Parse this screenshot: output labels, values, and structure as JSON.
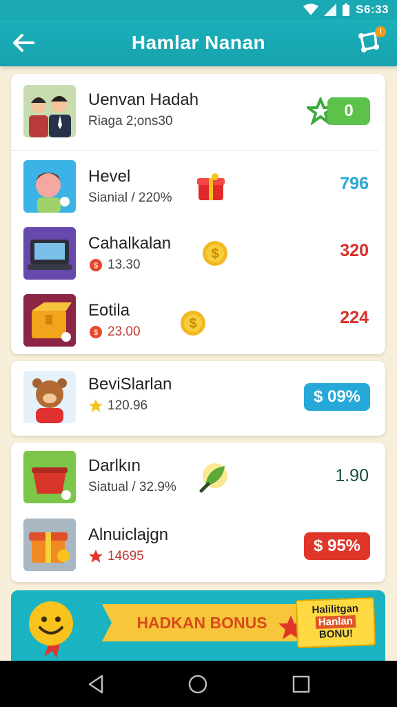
{
  "status_bar": {
    "time": "S6:33"
  },
  "header": {
    "title": "Hamlar Nanan",
    "notification_badge": "!"
  },
  "cards": [
    {
      "rows": [
        {
          "title": "Uenvan Hadah",
          "subtitle": "Riaga 2;ons30",
          "value": "0",
          "value_color": "#ffffff",
          "value_style": "green-pill"
        },
        {
          "title": "Hevel",
          "subtitle": "Sianial / 220%",
          "value": "796",
          "value_color": "#2aa6d6"
        },
        {
          "title": "Cahalkalan",
          "subtitle": "13.30",
          "value": "320",
          "value_color": "#d9302a"
        },
        {
          "title": "Eotila",
          "subtitle": "23.00",
          "value": "224",
          "value_color": "#d9302a"
        }
      ]
    },
    {
      "rows": [
        {
          "title": "BeviSlarlan",
          "subtitle": "120.96",
          "value": "$ 09%",
          "value_color": "#2aa6d6"
        }
      ]
    },
    {
      "rows": [
        {
          "title": "Darlkın",
          "subtitle": "Siatual / 32.9%",
          "value": "1.90",
          "value_color": "#1b4d3e"
        },
        {
          "title": "Alnuiclajgn",
          "subtitle": "14695",
          "value": "$ 95%",
          "value_color": "#e0362a"
        }
      ]
    }
  ],
  "banner": {
    "ribbon_text": "HADKAN BONUS",
    "sign_line1": "Halilitgan",
    "sign_line2": "Hanlan",
    "sign_line3": "BONU!"
  },
  "icons": {
    "back": "arrow-left",
    "share": "share-network",
    "star": "star",
    "coin": "coin",
    "gift": "gift"
  }
}
